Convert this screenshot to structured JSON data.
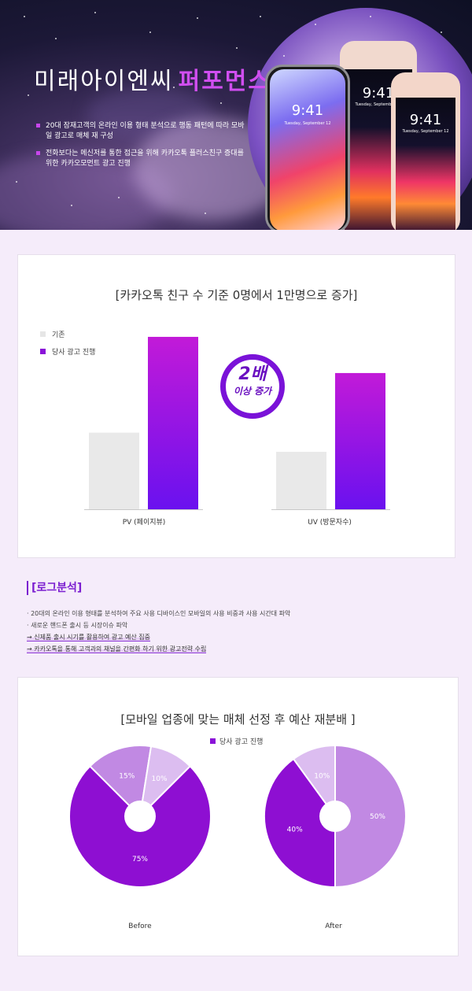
{
  "hero": {
    "title_main": "미래아이엔씨",
    "title_highlight": "퍼포먼스",
    "bullets": [
      "20대 잠재고객의 온라인 이용 형태 분석으로 행동 패턴에 따라 모바일 광고로 매체 재 구성",
      "전화보다는 메신저를 통한 접근을 위해 카카오톡 플러스친구 증대를 위한 카카오모먼트 광고 진행"
    ],
    "phone_time": "9:41",
    "phone_date": "Tuesday, September 12"
  },
  "colors": {
    "accent": "#8a12d8",
    "bar_base": "#e9e9e9",
    "bar_top": "#c21ad8",
    "bar_bottom": "#6a11ef",
    "pie_dark": "#8e0fd2",
    "pie_mid": "#c189e3",
    "pie_light": "#dcbdf0"
  },
  "bar_section": {
    "title": "[카카오톡 친구 수 기준 0명에서 1만명으로 증가]",
    "legend": [
      "기존",
      "당사 광고 진행"
    ],
    "badge_big": "2배",
    "badge_small": "이상 증가"
  },
  "log": {
    "title": "[로그분석]",
    "items": [
      "· 20대의 온라인 이용 형태를 분석하여 주요 사용 디바이스인 모바일의 사용 비중과 사용 시간대 파악",
      "· 새로운 핸드폰 출시 등 시장이슈 파악",
      "→ 신제품 출시 시기를 활용하여 광고 예산 집중",
      "→ 카카오톡을 통해 고객과의 채널을 간편화 하기 위한 광고전략 수립"
    ]
  },
  "pie_section": {
    "title": "[모바일 업종에 맞는 매체 선정 후 예산 재분배 ]",
    "legend": "당사 광고 진행"
  },
  "chart_data": [
    {
      "type": "bar",
      "title": "[카카오톡 친구 수 기준 0명에서 1만명으로 증가]",
      "categories": [
        "PV (페이지뷰)",
        "UV (방문자수)"
      ],
      "series": [
        {
          "name": "기존",
          "values": [
            36,
            27
          ]
        },
        {
          "name": "당사 광고 진행",
          "values": [
            81,
            64
          ]
        }
      ],
      "ylim": [
        0,
        100
      ],
      "grid": false,
      "legend_position": "top-left"
    },
    {
      "type": "pie",
      "title": "Before",
      "slices": [
        {
          "label": "75%",
          "value": 75
        },
        {
          "label": "15%",
          "value": 15
        },
        {
          "label": "10%",
          "value": 10
        }
      ]
    },
    {
      "type": "pie",
      "title": "After",
      "slices": [
        {
          "label": "50%",
          "value": 50
        },
        {
          "label": "40%",
          "value": 40
        },
        {
          "label": "10%",
          "value": 10
        }
      ]
    }
  ]
}
